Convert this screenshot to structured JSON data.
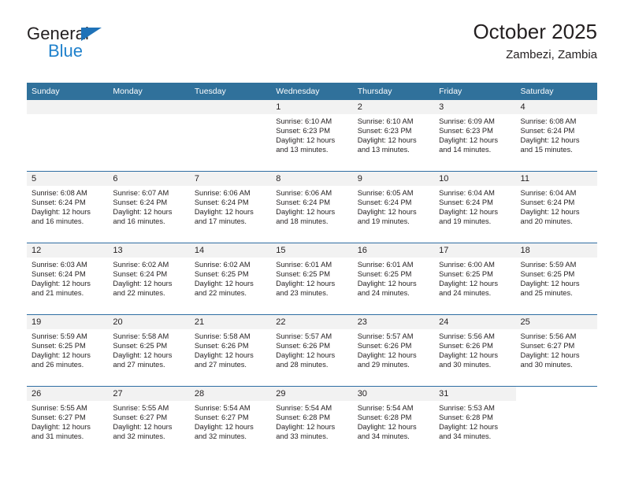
{
  "brand": {
    "line1": "General",
    "line2": "Blue",
    "triangle_color": "#1f72b8",
    "blue_color": "#1f81cc"
  },
  "header": {
    "title": "October 2025",
    "subtitle": "Zambezi, Zambia"
  },
  "colors": {
    "header_row_bg": "#30719b",
    "header_row_text": "#ffffff",
    "daynum_band_bg": "#f2f2f2",
    "row_divider": "#2f6ea3",
    "text": "#231f20"
  },
  "weekdays": [
    "Sunday",
    "Monday",
    "Tuesday",
    "Wednesday",
    "Thursday",
    "Friday",
    "Saturday"
  ],
  "labels": {
    "sunrise": "Sunrise:",
    "sunset": "Sunset:",
    "daylight": "Daylight:"
  },
  "weeks": [
    [
      {
        "day": "",
        "l1": "",
        "l2": "",
        "l3": "",
        "l4": ""
      },
      {
        "day": "",
        "l1": "",
        "l2": "",
        "l3": "",
        "l4": ""
      },
      {
        "day": "",
        "l1": "",
        "l2": "",
        "l3": "",
        "l4": ""
      },
      {
        "day": "1",
        "l1": "Sunrise: 6:10 AM",
        "l2": "Sunset: 6:23 PM",
        "l3": "Daylight: 12 hours",
        "l4": "and 13 minutes."
      },
      {
        "day": "2",
        "l1": "Sunrise: 6:10 AM",
        "l2": "Sunset: 6:23 PM",
        "l3": "Daylight: 12 hours",
        "l4": "and 13 minutes."
      },
      {
        "day": "3",
        "l1": "Sunrise: 6:09 AM",
        "l2": "Sunset: 6:23 PM",
        "l3": "Daylight: 12 hours",
        "l4": "and 14 minutes."
      },
      {
        "day": "4",
        "l1": "Sunrise: 6:08 AM",
        "l2": "Sunset: 6:24 PM",
        "l3": "Daylight: 12 hours",
        "l4": "and 15 minutes."
      }
    ],
    [
      {
        "day": "5",
        "l1": "Sunrise: 6:08 AM",
        "l2": "Sunset: 6:24 PM",
        "l3": "Daylight: 12 hours",
        "l4": "and 16 minutes."
      },
      {
        "day": "6",
        "l1": "Sunrise: 6:07 AM",
        "l2": "Sunset: 6:24 PM",
        "l3": "Daylight: 12 hours",
        "l4": "and 16 minutes."
      },
      {
        "day": "7",
        "l1": "Sunrise: 6:06 AM",
        "l2": "Sunset: 6:24 PM",
        "l3": "Daylight: 12 hours",
        "l4": "and 17 minutes."
      },
      {
        "day": "8",
        "l1": "Sunrise: 6:06 AM",
        "l2": "Sunset: 6:24 PM",
        "l3": "Daylight: 12 hours",
        "l4": "and 18 minutes."
      },
      {
        "day": "9",
        "l1": "Sunrise: 6:05 AM",
        "l2": "Sunset: 6:24 PM",
        "l3": "Daylight: 12 hours",
        "l4": "and 19 minutes."
      },
      {
        "day": "10",
        "l1": "Sunrise: 6:04 AM",
        "l2": "Sunset: 6:24 PM",
        "l3": "Daylight: 12 hours",
        "l4": "and 19 minutes."
      },
      {
        "day": "11",
        "l1": "Sunrise: 6:04 AM",
        "l2": "Sunset: 6:24 PM",
        "l3": "Daylight: 12 hours",
        "l4": "and 20 minutes."
      }
    ],
    [
      {
        "day": "12",
        "l1": "Sunrise: 6:03 AM",
        "l2": "Sunset: 6:24 PM",
        "l3": "Daylight: 12 hours",
        "l4": "and 21 minutes."
      },
      {
        "day": "13",
        "l1": "Sunrise: 6:02 AM",
        "l2": "Sunset: 6:24 PM",
        "l3": "Daylight: 12 hours",
        "l4": "and 22 minutes."
      },
      {
        "day": "14",
        "l1": "Sunrise: 6:02 AM",
        "l2": "Sunset: 6:25 PM",
        "l3": "Daylight: 12 hours",
        "l4": "and 22 minutes."
      },
      {
        "day": "15",
        "l1": "Sunrise: 6:01 AM",
        "l2": "Sunset: 6:25 PM",
        "l3": "Daylight: 12 hours",
        "l4": "and 23 minutes."
      },
      {
        "day": "16",
        "l1": "Sunrise: 6:01 AM",
        "l2": "Sunset: 6:25 PM",
        "l3": "Daylight: 12 hours",
        "l4": "and 24 minutes."
      },
      {
        "day": "17",
        "l1": "Sunrise: 6:00 AM",
        "l2": "Sunset: 6:25 PM",
        "l3": "Daylight: 12 hours",
        "l4": "and 24 minutes."
      },
      {
        "day": "18",
        "l1": "Sunrise: 5:59 AM",
        "l2": "Sunset: 6:25 PM",
        "l3": "Daylight: 12 hours",
        "l4": "and 25 minutes."
      }
    ],
    [
      {
        "day": "19",
        "l1": "Sunrise: 5:59 AM",
        "l2": "Sunset: 6:25 PM",
        "l3": "Daylight: 12 hours",
        "l4": "and 26 minutes."
      },
      {
        "day": "20",
        "l1": "Sunrise: 5:58 AM",
        "l2": "Sunset: 6:25 PM",
        "l3": "Daylight: 12 hours",
        "l4": "and 27 minutes."
      },
      {
        "day": "21",
        "l1": "Sunrise: 5:58 AM",
        "l2": "Sunset: 6:26 PM",
        "l3": "Daylight: 12 hours",
        "l4": "and 27 minutes."
      },
      {
        "day": "22",
        "l1": "Sunrise: 5:57 AM",
        "l2": "Sunset: 6:26 PM",
        "l3": "Daylight: 12 hours",
        "l4": "and 28 minutes."
      },
      {
        "day": "23",
        "l1": "Sunrise: 5:57 AM",
        "l2": "Sunset: 6:26 PM",
        "l3": "Daylight: 12 hours",
        "l4": "and 29 minutes."
      },
      {
        "day": "24",
        "l1": "Sunrise: 5:56 AM",
        "l2": "Sunset: 6:26 PM",
        "l3": "Daylight: 12 hours",
        "l4": "and 30 minutes."
      },
      {
        "day": "25",
        "l1": "Sunrise: 5:56 AM",
        "l2": "Sunset: 6:27 PM",
        "l3": "Daylight: 12 hours",
        "l4": "and 30 minutes."
      }
    ],
    [
      {
        "day": "26",
        "l1": "Sunrise: 5:55 AM",
        "l2": "Sunset: 6:27 PM",
        "l3": "Daylight: 12 hours",
        "l4": "and 31 minutes."
      },
      {
        "day": "27",
        "l1": "Sunrise: 5:55 AM",
        "l2": "Sunset: 6:27 PM",
        "l3": "Daylight: 12 hours",
        "l4": "and 32 minutes."
      },
      {
        "day": "28",
        "l1": "Sunrise: 5:54 AM",
        "l2": "Sunset: 6:27 PM",
        "l3": "Daylight: 12 hours",
        "l4": "and 32 minutes."
      },
      {
        "day": "29",
        "l1": "Sunrise: 5:54 AM",
        "l2": "Sunset: 6:28 PM",
        "l3": "Daylight: 12 hours",
        "l4": "and 33 minutes."
      },
      {
        "day": "30",
        "l1": "Sunrise: 5:54 AM",
        "l2": "Sunset: 6:28 PM",
        "l3": "Daylight: 12 hours",
        "l4": "and 34 minutes."
      },
      {
        "day": "31",
        "l1": "Sunrise: 5:53 AM",
        "l2": "Sunset: 6:28 PM",
        "l3": "Daylight: 12 hours",
        "l4": "and 34 minutes."
      },
      {
        "day": "",
        "l1": "",
        "l2": "",
        "l3": "",
        "l4": ""
      }
    ]
  ]
}
